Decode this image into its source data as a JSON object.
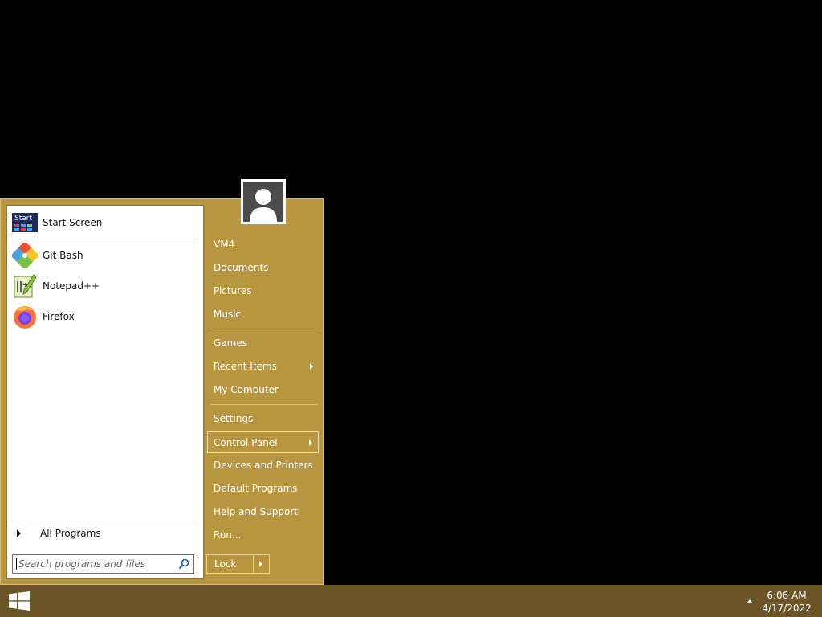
{
  "left_pane": {
    "pinned": [
      {
        "label": "Start Screen",
        "icon": "start-screen-icon",
        "icon_text": "Start"
      },
      {
        "label": "Git Bash",
        "icon": "git-bash-icon"
      },
      {
        "label": "Notepad++",
        "icon": "notepad-plus-plus-icon"
      },
      {
        "label": "Firefox",
        "icon": "firefox-icon"
      }
    ],
    "all_programs_label": "All Programs",
    "search_placeholder": "Search programs and files"
  },
  "right_pane": {
    "items": [
      {
        "label": "VM4"
      },
      {
        "label": "Documents"
      },
      {
        "label": "Pictures"
      },
      {
        "label": "Music"
      },
      {
        "label": "Games"
      },
      {
        "label": "Recent Items",
        "submenu": true
      },
      {
        "label": "My Computer"
      },
      {
        "label": "Settings"
      },
      {
        "label": "Control Panel",
        "submenu": true,
        "highlighted": true
      },
      {
        "label": "Devices and Printers"
      },
      {
        "label": "Default Programs"
      },
      {
        "label": "Help and Support"
      },
      {
        "label": "Run..."
      }
    ],
    "lock_label": "Lock"
  },
  "taskbar": {
    "time": "6:06 AM",
    "date": "4/17/2022"
  },
  "colors": {
    "menu_background": "#b8953f",
    "taskbar_background": "#6b5425",
    "desktop_background": "#000000"
  }
}
